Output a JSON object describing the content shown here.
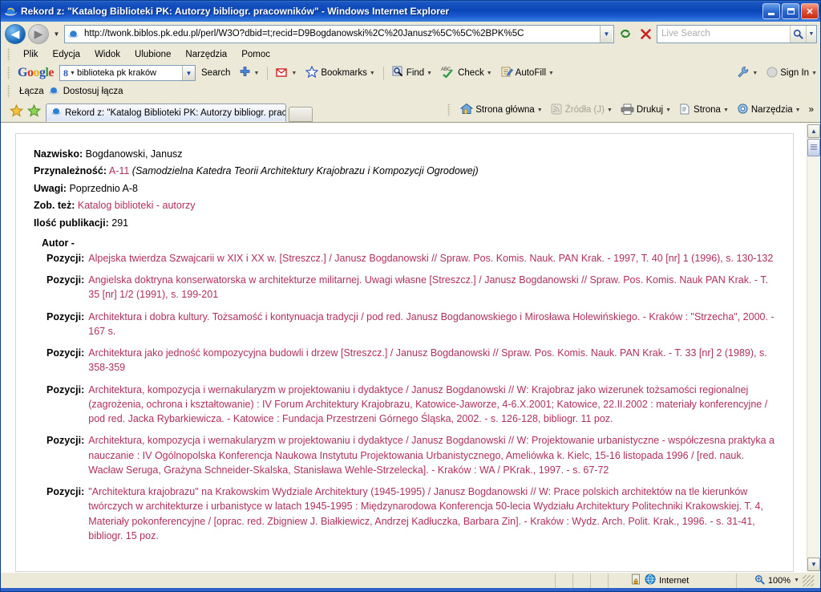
{
  "window": {
    "title": "Rekord z: \"Katalog Biblioteki PK: Autorzy bibliogr. pracowników\" - Windows Internet Explorer",
    "minimize_label": "Minimalizuj",
    "maximize_label": "Maksymalizuj",
    "close_label": "Zamknij"
  },
  "address": {
    "url": "http://twonk.biblos.pk.edu.pl/perl/W3O?dbid=t;recid=D9Bogdanowski%2C%20Janusz%5C%5C%2BPK%5C",
    "back_label": "Wstecz",
    "forward_label": "Dalej",
    "refresh_label": "Odśwież",
    "stop_label": "Zatrzymaj",
    "search_placeholder": "Live Search",
    "search_value": "",
    "search_go_label": "Szukaj"
  },
  "menu": {
    "items": [
      {
        "label": "Plik",
        "accel": "P"
      },
      {
        "label": "Edycja",
        "accel": "E"
      },
      {
        "label": "Widok",
        "accel": "W"
      },
      {
        "label": "Ulubione",
        "accel": "U"
      },
      {
        "label": "Narzędzia",
        "accel": "N"
      },
      {
        "label": "Pomoc",
        "accel": "c"
      }
    ]
  },
  "google_toolbar": {
    "logo": "Google",
    "query": "biblioteka pk kraków",
    "search_label": "Search",
    "plus_label": "Share",
    "gmail_label": "Gmail",
    "bookmarks_label": "Bookmarks",
    "find_label": "Find",
    "check_label": "Check",
    "autofill_label": "AutoFill",
    "settings_label": "Ustawienia",
    "signin_label": "Sign In"
  },
  "links_bar": {
    "label": "Łącza",
    "customize": "Dostosuj łącza"
  },
  "tabs": {
    "favorites_label": "Ulubione",
    "add_favorite_label": "Dodaj do Ulubionych",
    "items": [
      {
        "title": "Rekord z: \"Katalog Biblioteki PK: Autorzy bibliogr. prac...",
        "active": true
      }
    ],
    "new_tab_label": "Nowa karta"
  },
  "command_bar": {
    "home_label": "Strona główna",
    "feeds_label": "Źródła (J)",
    "print_label": "Drukuj",
    "page_label": "Strona",
    "tools_label": "Narzędzia",
    "overflow_label": "»"
  },
  "record": {
    "fields": [
      {
        "label": "Nazwisko:",
        "value": "Bogdanowski, Janusz"
      },
      {
        "label": "Przynależność:",
        "value_link": "A-11",
        "value_italic": "(Samodzielna Katedra Teorii Architektury Krajobrazu i Kompozycji Ogrodowej)"
      },
      {
        "label": "Uwagi:",
        "value": "Poprzednio A-8"
      },
      {
        "label": "Zob. też:",
        "value_link": "Katalog biblioteki - autorzy"
      },
      {
        "label": "Ilość publikacji:",
        "value": "291"
      }
    ],
    "author_heading": "Autor -",
    "entry_label": "Pozycji:",
    "entries": [
      "Alpejska twierdza Szwajcarii w XIX i XX w. [Streszcz.] / Janusz Bogdanowski // Spraw. Pos. Komis. Nauk. PAN Krak. - 1997, T. 40 [nr] 1 (1996), s. 130-132",
      "Angielska doktryna konserwatorska w architekturze militarnej. Uwagi własne [Streszcz.] / Janusz Bogdanowski // Spraw. Pos. Komis. Nauk PAN Krak. - T. 35 [nr] 1/2 (1991), s. 199-201",
      "Architektura i dobra kultury. Tożsamość i kontynuacja tradycji / pod red. Janusz Bogdanowskiego i Mirosława Holewińskiego. - Kraków : \"Strzecha\", 2000. - 167 s.",
      "Architektura jako jedność kompozycyjna budowli i drzew [Streszcz.] / Janusz Bogdanowski // Spraw. Pos. Komis. Nauk. PAN Krak. - T. 33 [nr] 2 (1989), s. 358-359",
      "Architektura, kompozycja i wernakularyzm w projektowaniu i dydaktyce / Janusz Bogdanowski // W: Krajobraz jako wizerunek tożsamości regionalnej (zagrożenia, ochrona i kształtowanie) : IV Forum Architektury Krajobrazu, Katowice-Jaworze, 4-6.X.2001; Katowice, 22.II.2002 : materiały konferencyjne / pod red. Jacka Rybarkiewicza. - Katowice : Fundacja Przestrzeni Górnego Śląska, 2002. - s. 126-128, bibliogr. 11 poz.",
      "Architektura, kompozycja i wernakularyzm w projektowaniu i dydaktyce / Janusz Bogdanowski // W: Projektowanie urbanistyczne - współczesna praktyka a nauczanie : IV Ogólnopolska Konferencja Naukowa Instytutu Projektowania Urbanistycznego, Ameliówka k. Kielc, 15-16 listopada 1996 / [red. nauk. Wacław Seruga, Grażyna Schneider-Skalska, Stanisława Wehle-Strzelecka]. - Kraków : WA / PKrak., 1997. - s. 67-72",
      "\"Architektura krajobrazu\" na Krakowskim Wydziale Architektury (1945-1995) / Janusz Bogdanowski // W: Prace polskich architektów na tle kierunków twórczych w architekturze i urbanistyce w latach 1945-1995 : Międzynarodowa Konferencja 50-lecia Wydziału Architektury Politechniki Krakowskiej. T. 4, Materiały pokonferencyjne / [oprac. red. Zbigniew J. Białkiewicz, Andrzej Kadłuczka, Barbara Zin]. - Kraków : Wydz. Arch. Polit. Krak., 1996. - s. 31-41, bibliogr. 15 poz."
    ]
  },
  "status_bar": {
    "message": "",
    "zone": "Internet",
    "zoom": "100%"
  },
  "colors": {
    "link": "#b0305a",
    "titlebar": "#0a46b8",
    "chrome": "#ece9d8"
  }
}
